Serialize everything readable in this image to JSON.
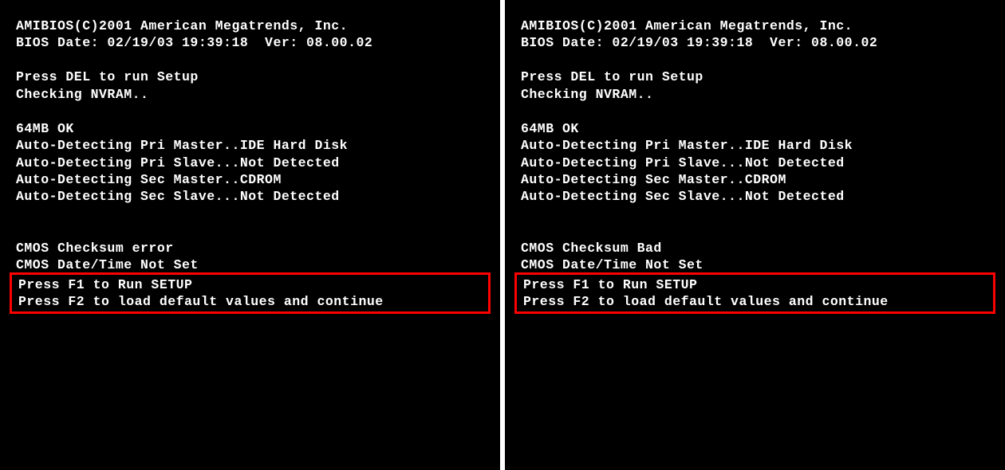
{
  "screens": [
    {
      "header_1": "AMIBIOS(C)2001 American Megatrends, Inc.",
      "header_2": "BIOS Date: 02/19/03 19:39:18  Ver: 08.00.02",
      "setup_prompt": "Press DEL to run Setup",
      "nvram_check": "Checking NVRAM..",
      "mem_status": "64MB OK",
      "detect_pri_master": "Auto-Detecting Pri Master..IDE Hard Disk",
      "detect_pri_slave": "Auto-Detecting Pri Slave...Not Detected",
      "detect_sec_master": "Auto-Detecting Sec Master..CDROM",
      "detect_sec_slave": "Auto-Detecting Sec Slave...Not Detected",
      "cmos_error_1": "CMOS Checksum error",
      "cmos_error_2": "CMOS Date/Time Not Set",
      "prompt_f1": "Press F1 to Run SETUP",
      "prompt_f2": "Press F2 to load default values and continue"
    },
    {
      "header_1": "AMIBIOS(C)2001 American Megatrends, Inc.",
      "header_2": "BIOS Date: 02/19/03 19:39:18  Ver: 08.00.02",
      "setup_prompt": "Press DEL to run Setup",
      "nvram_check": "Checking NVRAM..",
      "mem_status": "64MB OK",
      "detect_pri_master": "Auto-Detecting Pri Master..IDE Hard Disk",
      "detect_pri_slave": "Auto-Detecting Pri Slave...Not Detected",
      "detect_sec_master": "Auto-Detecting Sec Master..CDROM",
      "detect_sec_slave": "Auto-Detecting Sec Slave...Not Detected",
      "cmos_error_1": "CMOS Checksum Bad",
      "cmos_error_2": "CMOS Date/Time Not Set",
      "prompt_f1": "Press F1 to Run SETUP",
      "prompt_f2": "Press F2 to load default values and continue"
    }
  ]
}
